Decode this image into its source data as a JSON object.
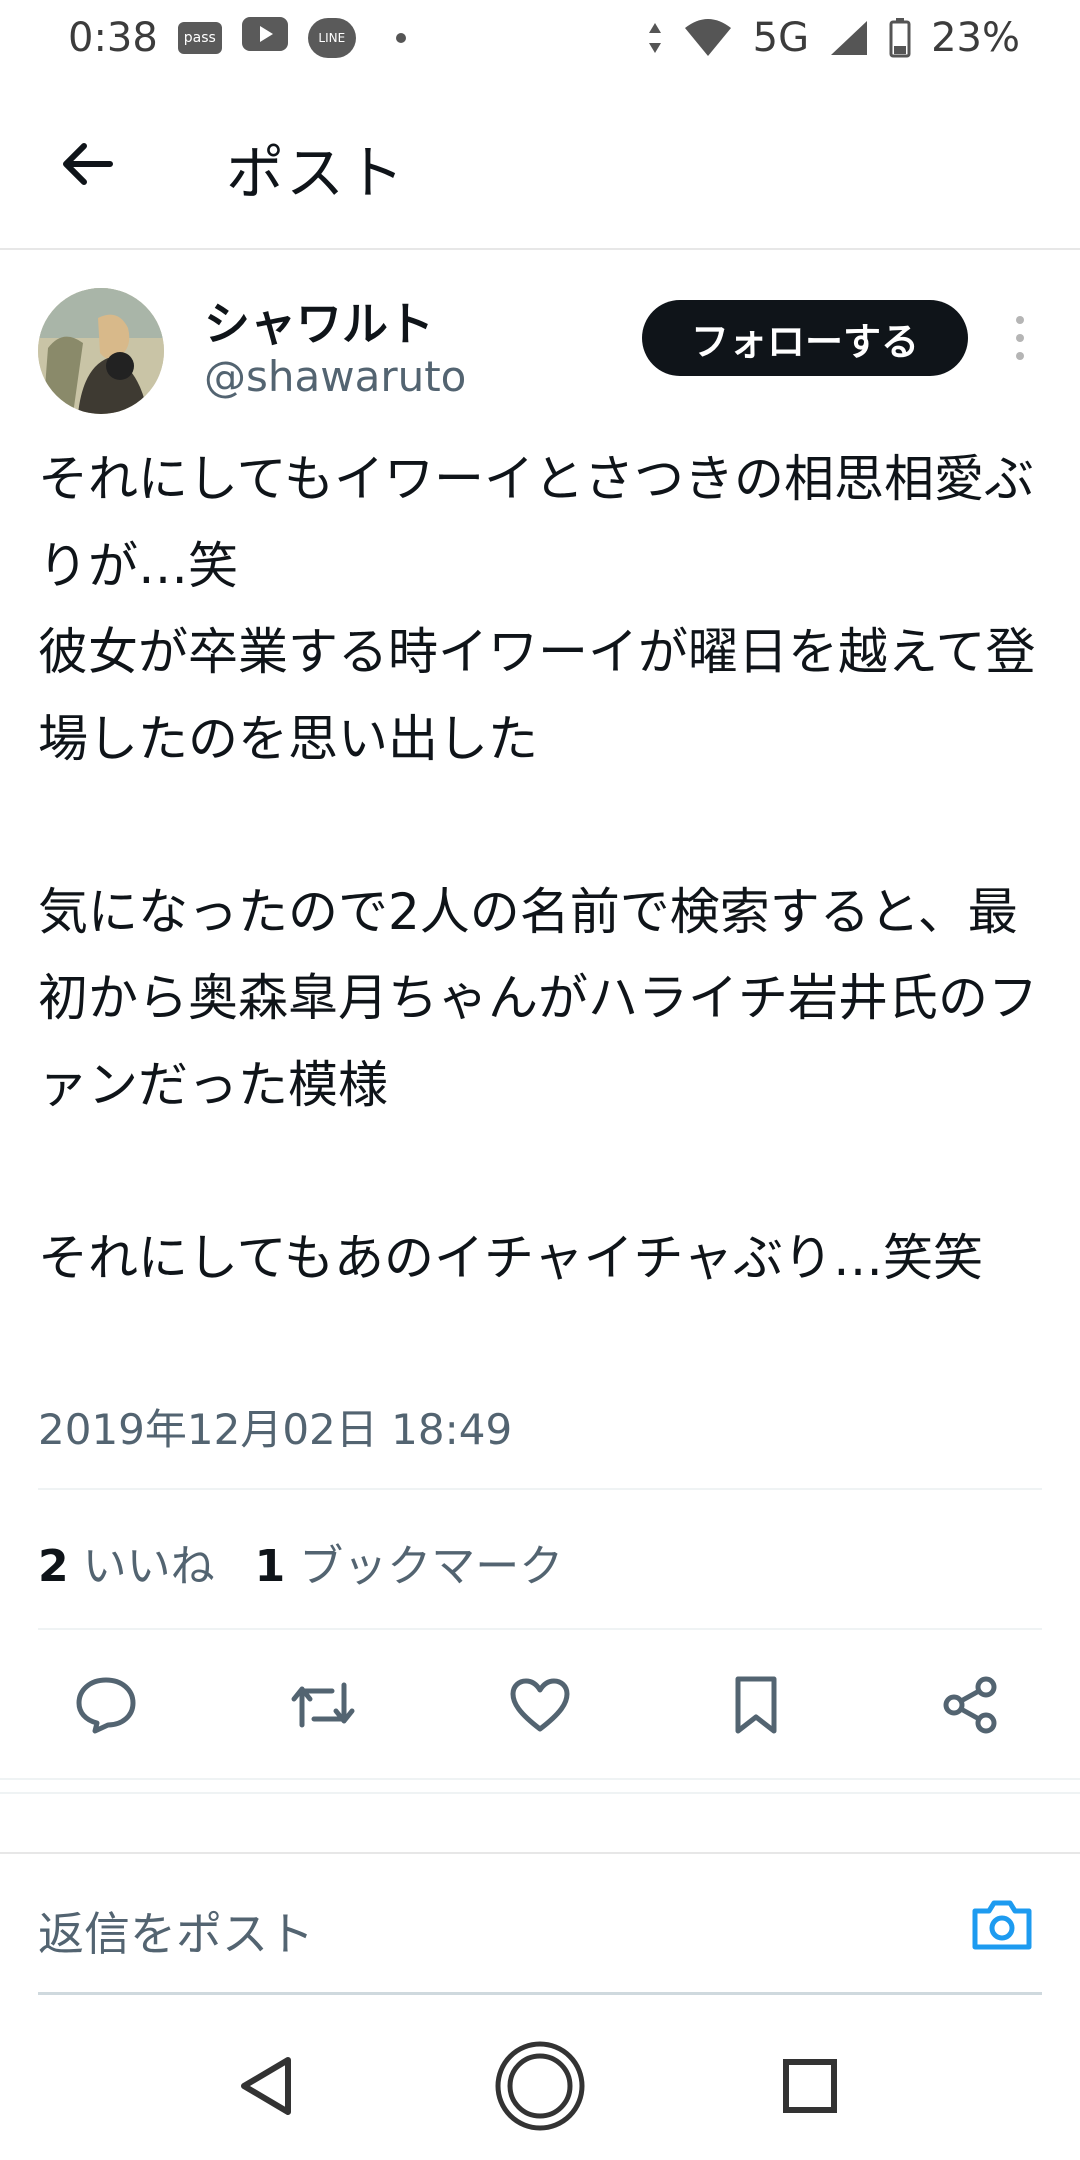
{
  "status_bar": {
    "time": "0:38",
    "left_icons": [
      "pass",
      "youtube-icon",
      "LINE",
      "dot"
    ],
    "pass_label": "pass",
    "line_label": "LINE",
    "network": "5G",
    "battery": "23%"
  },
  "header": {
    "title": "ポスト"
  },
  "post": {
    "author_name": "シャワルト",
    "author_handle": "@shawaruto",
    "follow_label": "フォローする",
    "text": "それにしてもイワーイとさつきの相思相愛ぶりが…笑\n彼女が卒業する時イワーイが曜日を越えて登場したのを思い出した\n\n気になったので2人の名前で検索すると、最初から奥森皐月ちゃんがハライチ岩井氏のファンだった模様\n\nそれにしてもあのイチャイチャぶり…笑笑",
    "date": "2019年12月02日 18:49",
    "likes_count": "2",
    "likes_label": "いいね",
    "bookmarks_count": "1",
    "bookmarks_label": "ブックマーク"
  },
  "actions": [
    "reply-icon",
    "repost-icon",
    "like-icon",
    "bookmark-icon",
    "share-icon"
  ],
  "reply_bar": {
    "placeholder": "返信をポスト"
  },
  "colors": {
    "text": "#0f1419",
    "secondary": "#536471",
    "accent": "#1d9bf0",
    "follow_bg": "#0f1419"
  }
}
